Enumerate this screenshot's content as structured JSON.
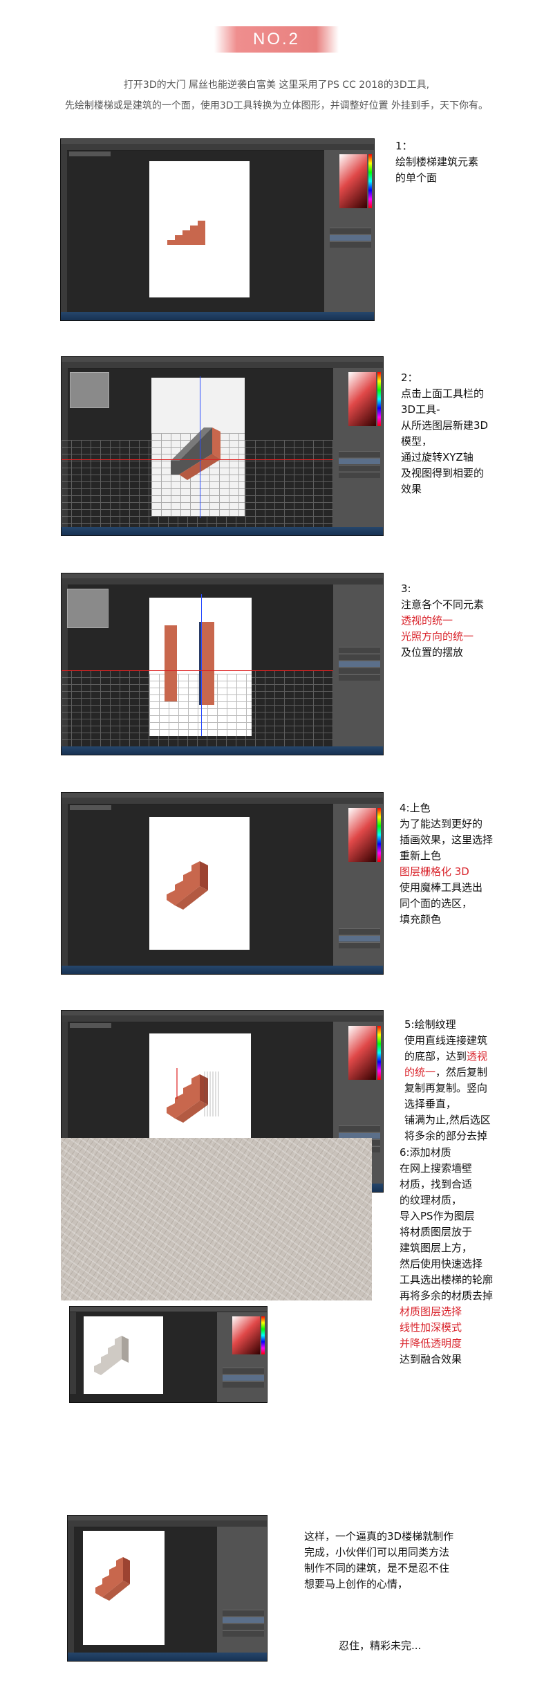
{
  "header": {
    "badge": "NO.2",
    "intro_line1": "打开3D的大门 屌丝也能逆袭白富美 这里采用了PS CC 2018的3D工具,",
    "intro_line2": "先绘制楼梯或是建筑的一个面，使用3D工具转换为立体图形，并调整好位置 外挂到手，天下你有。"
  },
  "steps": [
    {
      "lines": [
        {
          "text": "1："
        },
        {
          "text": "绘制楼梯建筑元素"
        },
        {
          "text": "的单个面"
        }
      ]
    },
    {
      "lines": [
        {
          "text": "2："
        },
        {
          "text": "点击上面工具栏的"
        },
        {
          "text": "3D工具-"
        },
        {
          "text": "从所选图层新建3D"
        },
        {
          "text": "模型，"
        },
        {
          "text": "通过旋转XYZ轴"
        },
        {
          "text": "及视图得到相要的"
        },
        {
          "text": "效果"
        }
      ]
    },
    {
      "lines": [
        {
          "text": "3:"
        },
        {
          "text": "注意各个不同元素"
        },
        {
          "text": "透视的统一",
          "red": true
        },
        {
          "text": "光照方向的统一",
          "red": true
        },
        {
          "text": "及位置的摆放"
        }
      ]
    },
    {
      "lines": [
        {
          "text": "4:上色"
        },
        {
          "text": "为了能达到更好的"
        },
        {
          "text": "插画效果，这里选择"
        },
        {
          "text": "重新上色"
        },
        {
          "text": "图层栅格化 3D",
          "red": true
        },
        {
          "text": "使用魔棒工具选出"
        },
        {
          "text": "同个面的选区，"
        },
        {
          "text": "填充颜色"
        }
      ]
    },
    {
      "lines": [
        {
          "text": "5:绘制纹理"
        },
        {
          "text": "使用直线连接建筑"
        },
        {
          "parts": [
            {
              "text": "的底部，达到"
            },
            {
              "text": "透视",
              "red": true
            }
          ]
        },
        {
          "parts": [
            {
              "text": "的统一",
              "red": true
            },
            {
              "text": "，然后复制"
            }
          ]
        },
        {
          "text": "复制再复制。竖向"
        },
        {
          "text": "选择垂直，"
        },
        {
          "text": "铺满为止,然后选区"
        },
        {
          "text": "将多余的部分去掉"
        }
      ]
    },
    {
      "lines": [
        {
          "text": "6:添加材质"
        },
        {
          "text": "在网上搜索墙壁"
        },
        {
          "text": "材质，找到合适"
        },
        {
          "text": "的纹理材质，"
        },
        {
          "text": "导入PS作为图层"
        },
        {
          "text": "将材质图层放于"
        },
        {
          "text": "建筑图层上方，"
        },
        {
          "text": "然后使用快速选择"
        },
        {
          "text": "工具选出楼梯的轮廓"
        },
        {
          "text": "再将多余的材质去掉"
        },
        {
          "text": "材质图层选择",
          "red": true
        },
        {
          "text": "线性加深模式",
          "red": true
        },
        {
          "text": "并降低透明度",
          "red": true
        },
        {
          "text": "达到融合效果"
        }
      ]
    }
  ],
  "ending": {
    "lines": [
      "这样，一个逼真的3D楼梯就制作",
      "完成，小伙伴们可以用同类方法",
      "制作不同的建筑，是不是忍不住",
      "想要马上创作的心情，"
    ],
    "closing": "忍住，精彩未完..."
  },
  "colors": {
    "accent_red": "#d9232b",
    "brick": "#c8674d",
    "brick_dark": "#9c4331",
    "banner": "#ec8a88"
  }
}
